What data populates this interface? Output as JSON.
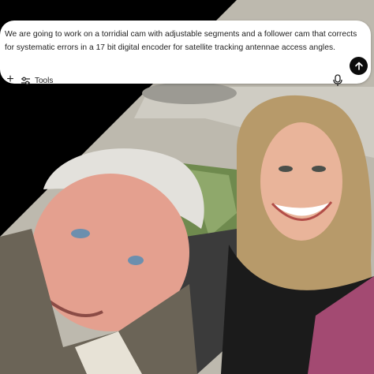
{
  "composer": {
    "prompt_text": "We are going to work on a torridial cam with adjustable segments and a follower cam that corrects for systematic errors in a 17 bit digital encoder for satellite tracking antennae access angles.",
    "tools_label": "Tools",
    "icons": {
      "plus": "plus-icon",
      "tools": "sliders-icon",
      "mic": "microphone-icon",
      "send": "arrow-up-icon"
    }
  },
  "photo": {
    "description_colors": {
      "background": "#000000",
      "car_interior": "#b9b6ad",
      "window_green": "#6f8a4e"
    }
  }
}
